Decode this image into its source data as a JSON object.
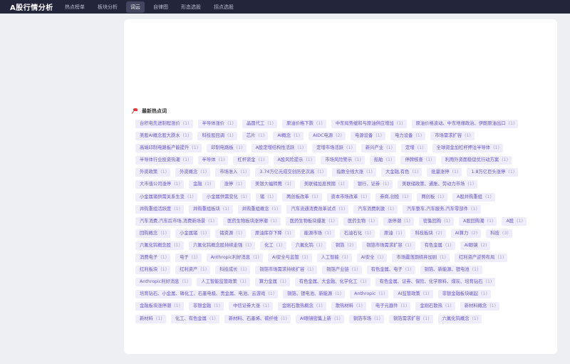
{
  "app": {
    "title": "A股行情分析"
  },
  "nav": {
    "items": [
      {
        "label": "热点榜单",
        "active": false
      },
      {
        "label": "板块分析",
        "active": false
      },
      {
        "label": "词云",
        "active": true
      },
      {
        "label": "自律图",
        "active": false
      },
      {
        "label": "形态选股",
        "active": false
      },
      {
        "label": "拐点选股",
        "active": false
      }
    ]
  },
  "section": {
    "title": "最新热点词",
    "icon": "pin-icon"
  },
  "colors": {
    "tag_bg": "#efedfb",
    "tag_text": "#6a55c2",
    "topbar": "#23253a"
  },
  "tags": [
    {
      "label": "台积电先进制程涨价",
      "count": "(1)"
    },
    {
      "label": "半导体涨价",
      "count": "(1)"
    },
    {
      "label": "晶圆代工",
      "count": "(1)"
    },
    {
      "label": "原油价格下跌",
      "count": "(1)"
    },
    {
      "label": "中东局势缓和与原油供应增加",
      "count": "(1)"
    },
    {
      "label": "原油价格波动、中东地缘政治、伊朗原油出口",
      "count": "(1)"
    },
    {
      "label": "美股AI概念股大跌水",
      "count": "(1)"
    },
    {
      "label": "科技股回调",
      "count": "(1)"
    },
    {
      "label": "芯片",
      "count": "(1)"
    },
    {
      "label": "AI概念",
      "count": "(1)"
    },
    {
      "label": "AIDC电源",
      "count": "(2)"
    },
    {
      "label": "电源设备",
      "count": "(1)"
    },
    {
      "label": "电力设备",
      "count": "(1)"
    },
    {
      "label": "市场需求扩容",
      "count": "(1)"
    },
    {
      "label": "高端印制电路板产能提升",
      "count": "(1)"
    },
    {
      "label": "印制电路板",
      "count": "(1)"
    },
    {
      "label": "A股定增结构性活跃",
      "count": "(1)"
    },
    {
      "label": "定增市场活跃",
      "count": "(1)"
    },
    {
      "label": "新兴产业",
      "count": "(1)"
    },
    {
      "label": "定增",
      "count": "(1)"
    },
    {
      "label": "全球资金加杠杆押注半导体",
      "count": "(1)"
    },
    {
      "label": "半导体行业投资热潮",
      "count": "(1)"
    },
    {
      "label": "半导体",
      "count": "(1)"
    },
    {
      "label": "杠杆资金",
      "count": "(1)"
    },
    {
      "label": "A股风险提示",
      "count": "(1)"
    },
    {
      "label": "市场风险警示",
      "count": "(1)"
    },
    {
      "label": "船舶",
      "count": "(1)"
    },
    {
      "label": "停牌核查",
      "count": "(1)"
    },
    {
      "label": "利用外资面稳促优行动方案",
      "count": "(1)"
    },
    {
      "label": "外资政策",
      "count": "(1)"
    },
    {
      "label": "外资概念",
      "count": "(1)"
    },
    {
      "label": "市场准入",
      "count": "(1)"
    },
    {
      "label": "3.74万亿元成交创历史次高",
      "count": "(1)"
    },
    {
      "label": "指数全线大涨",
      "count": "(1)"
    },
    {
      "label": "大金融,有色",
      "count": "(1)"
    },
    {
      "label": "批量涨停",
      "count": "(1)"
    },
    {
      "label": "1.8万亿巨头涨停",
      "count": "(1)"
    },
    {
      "label": "大市值公司涨停",
      "count": "(1)"
    },
    {
      "label": "金融",
      "count": "(1)"
    },
    {
      "label": "涨停",
      "count": "(1)"
    },
    {
      "label": "美银大幅转鹰",
      "count": "(1)"
    },
    {
      "label": "美联储加息预期",
      "count": "(1)"
    },
    {
      "label": "银行、证券",
      "count": "(1)"
    },
    {
      "label": "美联储政策、通胀、劳动力市场",
      "count": "(1)"
    },
    {
      "label": "小金属锗供需关系生变",
      "count": "(1)"
    },
    {
      "label": "小金属供需变化",
      "count": "(1)"
    },
    {
      "label": "锗",
      "count": "(1)"
    },
    {
      "label": "两创板改革",
      "count": "(1)"
    },
    {
      "label": "资本市场改革",
      "count": "(1)"
    },
    {
      "label": "券商,创投",
      "count": "(1)"
    },
    {
      "label": "两创板",
      "count": "(1)"
    },
    {
      "label": "A股并购重组",
      "count": "(1)"
    },
    {
      "label": "并购重组活跃度",
      "count": "(1)"
    },
    {
      "label": "并购重组板块",
      "count": "(1)"
    },
    {
      "label": "并购重组概念",
      "count": "(1)"
    },
    {
      "label": "汽车流通消费改革试点",
      "count": "(1)"
    },
    {
      "label": "汽车消费刺激",
      "count": "(1)"
    },
    {
      "label": "汽车整车,汽车服务,汽车零部件",
      "count": "(1)"
    },
    {
      "label": "汽车消费,汽车后市场,消费新场景",
      "count": "(1)"
    },
    {
      "label": "医药生物板块涨停潮",
      "count": "(1)"
    },
    {
      "label": "医药生物板块爆发",
      "count": "(1)"
    },
    {
      "label": "医药生物",
      "count": "(1)"
    },
    {
      "label": "涨停潮",
      "count": "(1)"
    },
    {
      "label": "密集回购",
      "count": "(1)"
    },
    {
      "label": "A股回购潮",
      "count": "(1)"
    },
    {
      "label": "A股",
      "count": "(1)"
    },
    {
      "label": "回购概念",
      "count": "(1)"
    },
    {
      "label": "小金属锗",
      "count": "(1)"
    },
    {
      "label": "锗资源",
      "count": "(1)"
    },
    {
      "label": "原油库存下降",
      "count": "(1)"
    },
    {
      "label": "能源市场",
      "count": "(1)"
    },
    {
      "label": "石油石化",
      "count": "(1)"
    },
    {
      "label": "原油",
      "count": "(1)"
    },
    {
      "label": "科技板块",
      "count": "(2)"
    },
    {
      "label": "AI算力",
      "count": "(2)"
    },
    {
      "label": "科技",
      "count": "(3)"
    },
    {
      "label": "六氟化钨概念股",
      "count": "(1)"
    },
    {
      "label": "六氟化钨概念股持续走强",
      "count": "(1)"
    },
    {
      "label": "化工",
      "count": "(1)"
    },
    {
      "label": "六氟化钨",
      "count": "(1)"
    },
    {
      "label": "铜箔",
      "count": "(2)"
    },
    {
      "label": "铜箔市场需求扩容",
      "count": "(1)"
    },
    {
      "label": "有色金属",
      "count": "(1)"
    },
    {
      "label": "AI眼镜",
      "count": "(2)"
    },
    {
      "label": "消费电子",
      "count": "(1)"
    },
    {
      "label": "电子",
      "count": "(1)"
    },
    {
      "label": "Anthropic利好消息",
      "count": "(1)"
    },
    {
      "label": "AI安全与监管",
      "count": "(1)"
    },
    {
      "label": "人工智能",
      "count": "(1)"
    },
    {
      "label": "AI安全",
      "count": "(1)"
    },
    {
      "label": "市场震荡期缔弃加剧",
      "count": "(1)"
    },
    {
      "label": "红利资产逆势布局",
      "count": "(1)"
    },
    {
      "label": "红利板块",
      "count": "(1)"
    },
    {
      "label": "红利资产",
      "count": "(1)"
    },
    {
      "label": "科技成长",
      "count": "(1)"
    },
    {
      "label": "铜箔市场需求持续扩容",
      "count": "(1)"
    },
    {
      "label": "铜箔产业链",
      "count": "(1)"
    },
    {
      "label": "有色金属、电子",
      "count": "(1)"
    },
    {
      "label": "铜箔、新能源、锂电池",
      "count": "(1)"
    },
    {
      "label": "Anthropic利好消息",
      "count": "(1)"
    },
    {
      "label": "人工智能监管政策",
      "count": "(1)"
    },
    {
      "label": "算力金属",
      "count": "(1)"
    },
    {
      "label": "有色金属、大金融、化学化工",
      "count": "(1)"
    },
    {
      "label": "有色金属、证券、保险、化学原料、煤炭、培育钻石",
      "count": "(1)"
    },
    {
      "label": "培育钻石、小金属、磷化工、石墨电极、贵金属、电池、云游戏",
      "count": "(1)"
    },
    {
      "label": "铜箔、锂电池、新能源",
      "count": "(1)"
    },
    {
      "label": "Anthropic",
      "count": "(1)"
    },
    {
      "label": "AI监管政策",
      "count": "(1)"
    },
    {
      "label": "非银金融板块崛起",
      "count": "(1)"
    },
    {
      "label": "金融板块涨停潮",
      "count": "(1)"
    },
    {
      "label": "非银金融",
      "count": "(1)"
    },
    {
      "label": "中信证券大涨",
      "count": "(1)"
    },
    {
      "label": "金刚石散热概念",
      "count": "(1)"
    },
    {
      "label": "散热材料",
      "count": "(1)"
    },
    {
      "label": "电子元器件",
      "count": "(1)"
    },
    {
      "label": "金刚石散热",
      "count": "(1)"
    },
    {
      "label": "新材料概念",
      "count": "(1)"
    },
    {
      "label": "新材料",
      "count": "(1)"
    },
    {
      "label": "化工、有色金属",
      "count": "(1)"
    },
    {
      "label": "新材料、石墨烯、碳纤维",
      "count": "(1)"
    },
    {
      "label": "AI眼镜密集上新",
      "count": "(1)"
    },
    {
      "label": "铜箔市场",
      "count": "(1)"
    },
    {
      "label": "铜箔需求扩容",
      "count": "(1)"
    },
    {
      "label": "六氟化钨概念",
      "count": "(1)"
    }
  ]
}
